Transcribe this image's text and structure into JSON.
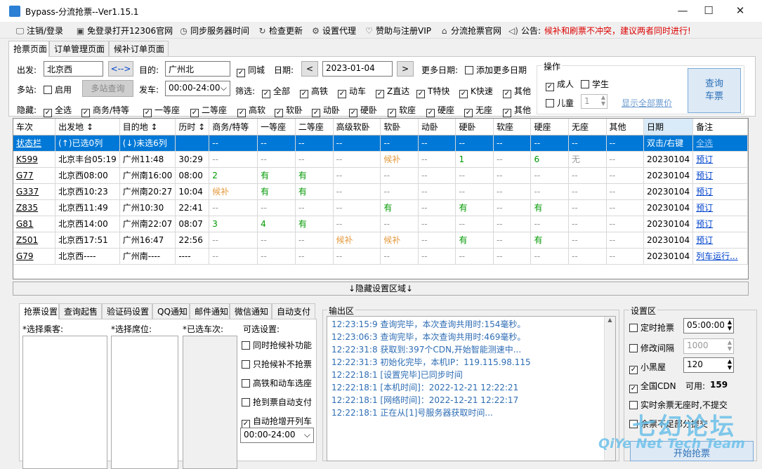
{
  "window": {
    "title": "Bypass-分流抢票--Ver1.15.1",
    "min": "—",
    "max": "☐",
    "close": "✕"
  },
  "toolbar": [
    {
      "icon": "🖵",
      "label": "注销/登录"
    },
    {
      "icon": "▣",
      "label": "免登录打开12306官网"
    },
    {
      "icon": "◷",
      "label": "同步服务器时间"
    },
    {
      "icon": "↻",
      "label": "检查更新"
    },
    {
      "icon": "⚙",
      "label": "设置代理"
    },
    {
      "icon": "♡",
      "label": "赞助与注册VIP"
    },
    {
      "icon": "⌂",
      "label": "分流抢票官网"
    },
    {
      "icon": "◁)",
      "label": "公告:"
    }
  ],
  "notice": "候补和刷票不冲突，建议两者同时进行!",
  "tabs": [
    "抢票页面",
    "订单管理页面",
    "候补订单页面"
  ],
  "query": {
    "from_label": "出发:",
    "from": "北京西",
    "swap": "<-->",
    "to_label": "目的:",
    "to": "广州北",
    "same_city": "同城",
    "date_label": "日期:",
    "date": "2023-01-04",
    "prev": "<",
    "next": ">",
    "more_dates_label": "更多日期:",
    "add_more_dates": "添加更多日期",
    "multi_label": "多站:",
    "enable": "启用",
    "multi_query": "多站查询",
    "depart_label": "发车:",
    "depart_time": "00:00-24:00",
    "filter_label": "筛选:",
    "filters": [
      "全部",
      "高铁",
      "动车",
      "Z直达",
      "T特快",
      "K快速",
      "其他"
    ],
    "hide_label": "隐藏:",
    "hide_opts": [
      "全选",
      "商务/特等",
      "一等座",
      "二等座",
      "高软",
      "软卧",
      "动卧",
      "硬卧",
      "软座",
      "硬座",
      "无座",
      "其他"
    ],
    "ops_title": "操作",
    "adult": "成人",
    "student": "学生",
    "child": "儿童",
    "child_count": "1",
    "show_prices": "显示全部票价",
    "query_btn_1": "查询",
    "query_btn_2": "车票"
  },
  "table": {
    "headers": [
      "车次",
      "出发地 ↕",
      "目的地 ↕",
      "历时 ↕",
      "商务/特等",
      "一等座",
      "二等座",
      "高级软卧",
      "软卧",
      "动卧",
      "硬卧",
      "软座",
      "硬座",
      "无座",
      "其他",
      "日期",
      "备注"
    ],
    "status_row": [
      "状态栏",
      "(↑)已选0列",
      "(↓)未选6列",
      "",
      "--",
      "--",
      "--",
      "--",
      "--",
      "--",
      "--",
      "--",
      "--",
      "--",
      "--",
      "双击/右键",
      "全选"
    ],
    "rows": [
      [
        "K599",
        "北京丰台05:19",
        "广州11:48",
        "30:29",
        "--",
        "--",
        "--",
        "--",
        "候补",
        "--",
        "1",
        "--",
        "6",
        "无",
        "--",
        "20230104",
        "预订"
      ],
      [
        "G77",
        "北京西08:00",
        "广州南16:00",
        "08:00",
        "2",
        "有",
        "有",
        "--",
        "--",
        "--",
        "--",
        "--",
        "--",
        "--",
        "--",
        "20230104",
        "预订"
      ],
      [
        "G337",
        "北京西10:23",
        "广州南20:27",
        "10:04",
        "候补",
        "有",
        "有",
        "--",
        "--",
        "--",
        "--",
        "--",
        "--",
        "--",
        "--",
        "20230104",
        "预订"
      ],
      [
        "Z835",
        "北京西11:49",
        "广州10:30",
        "22:41",
        "--",
        "--",
        "--",
        "--",
        "有",
        "--",
        "有",
        "--",
        "有",
        "--",
        "--",
        "20230104",
        "预订"
      ],
      [
        "G81",
        "北京西14:00",
        "广州南22:07",
        "08:07",
        "3",
        "4",
        "有",
        "--",
        "--",
        "--",
        "--",
        "--",
        "--",
        "--",
        "--",
        "20230104",
        "预订"
      ],
      [
        "Z501",
        "北京西17:51",
        "广州16:47",
        "22:56",
        "--",
        "--",
        "--",
        "候补",
        "候补",
        "--",
        "有",
        "--",
        "有",
        "--",
        "--",
        "20230104",
        "预订"
      ],
      [
        "G79",
        "北京西----",
        "广州南----",
        "----",
        "--",
        "--",
        "--",
        "--",
        "--",
        "--",
        "--",
        "--",
        "--",
        "--",
        "--",
        "20230104",
        "列车运行..."
      ]
    ]
  },
  "hide_bar": "↓隐藏设置区域↓",
  "settings_tabs": [
    "抢票设置",
    "查询起售",
    "验证码设置",
    "QQ通知",
    "邮件通知",
    "微信通知",
    "自动支付"
  ],
  "settings": {
    "passenger_label": "*选择乘客:",
    "seat_label": "*选择席位:",
    "train_label": "*已选车次:",
    "optional_label": "可选设置:",
    "options": [
      {
        "label": "同时抢候补功能",
        "checked": false
      },
      {
        "label": "只抢候补不抢票",
        "checked": false
      },
      {
        "label": "高铁和动车选座",
        "checked": false
      },
      {
        "label": "抢到票自动支付",
        "checked": false
      },
      {
        "label": "自动抢增开列车",
        "checked": true
      }
    ],
    "time_range": "00:00-24:00"
  },
  "output": {
    "title": "输出区",
    "lines": [
      "12:23:15:9  查询完毕，本次查询共用时:154毫秒。",
      "12:23:06:3  查询完毕，本次查询共用时:469毫秒。",
      "12:22:31:8  获取到:397个CDN,开始智能测速中...",
      "12:22:31:3  初始化完毕，本机IP：119.115.98.115",
      "12:22:18:1  [设置完毕]已同步时间",
      "12:22:18:1  [本机时间]：2022-12-21 12:22:21",
      "12:22:18:1  [网络时间]：2022-12-21 12:22:17",
      "12:22:18:1  正在从[1]号服务器获取时间..."
    ]
  },
  "settings_area": {
    "title": "设置区",
    "timed": {
      "label": "定时抢票",
      "checked": false,
      "value": "05:00:00"
    },
    "interval": {
      "label": "修改间隔",
      "checked": false,
      "value": "1000"
    },
    "blacklist": {
      "label": "小黑屋",
      "checked": true,
      "value": "120"
    },
    "cdn": {
      "label": "全国CDN",
      "checked": true,
      "avail_label": "可用:",
      "avail": "159"
    },
    "no_submit": {
      "label": "实时余票无座时,不提交",
      "checked": false
    },
    "partial": {
      "label": "余票不足部分提交",
      "checked": false
    },
    "start_btn": "开始抢票"
  },
  "watermark": {
    "cn": "七幻论坛",
    "en": "QiYe Net Tech Team"
  },
  "colors": {
    "selected": "#0078d7",
    "link": "#0044cc",
    "green": "#009900",
    "orange": "#e49a3e",
    "notice": "#dd0000",
    "log": "#2e6db4"
  }
}
